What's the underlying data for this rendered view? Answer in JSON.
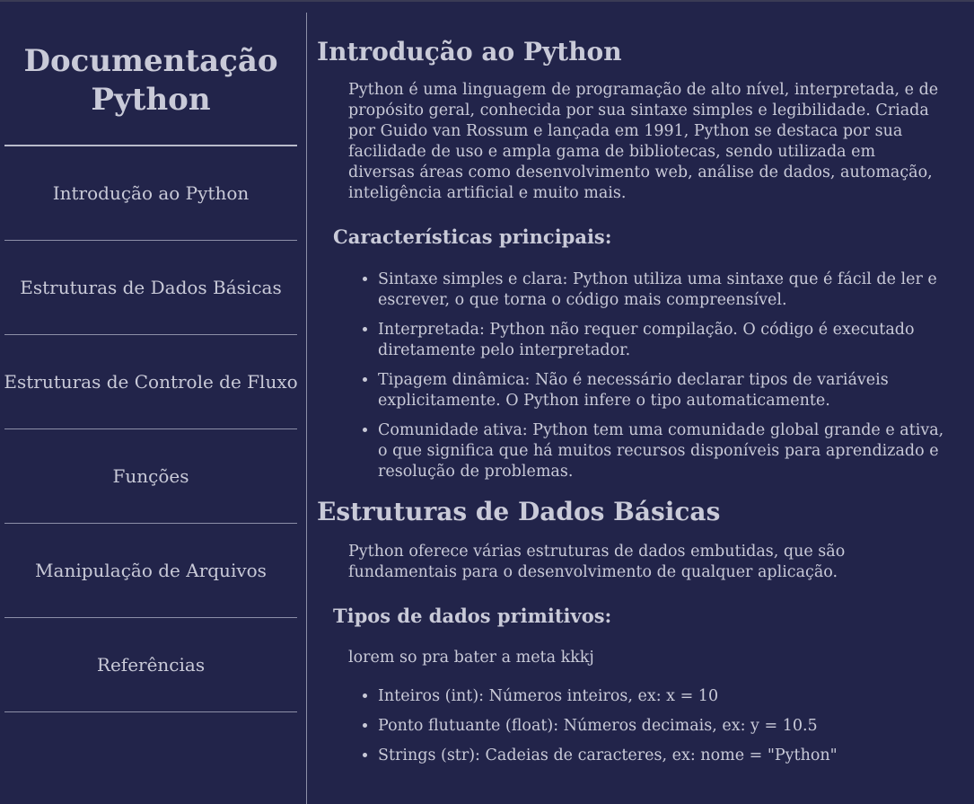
{
  "sidebar": {
    "title_line1": "Documentação",
    "title_line2": "Python",
    "items": [
      {
        "label": "Introdução ao Python"
      },
      {
        "label": "Estruturas de Dados Básicas"
      },
      {
        "label": "Estruturas de Controle de Fluxo"
      },
      {
        "label": "Funções"
      },
      {
        "label": "Manipulação de Arquivos"
      },
      {
        "label": "Referências"
      }
    ]
  },
  "sections": [
    {
      "title": "Introdução ao Python",
      "intro": "Python é uma linguagem de programação de alto nível, interpretada, e de propósito geral, conhecida por sua sintaxe simples e legibilidade. Criada por Guido van Rossum e lançada em 1991, Python se destaca por sua facilidade de uso e ampla gama de bibliotecas, sendo utilizada em diversas áreas como desenvolvimento web, análise de dados, automação, inteligência artificial e muito mais.",
      "subtitle": "Características principais:",
      "bullets": [
        "Sintaxe simples e clara: Python utiliza uma sintaxe que é fácil de ler e escrever, o que torna o código mais compreensível.",
        "Interpretada: Python não requer compilação. O código é executado diretamente pelo interpretador.",
        "Tipagem dinâmica: Não é necessário declarar tipos de variáveis explicitamente. O Python infere o tipo automaticamente.",
        "Comunidade ativa: Python tem uma comunidade global grande e ativa, o que significa que há muitos recursos disponíveis para aprendizado e resolução de problemas."
      ]
    },
    {
      "title": "Estruturas de Dados Básicas",
      "intro": "Python oferece várias estruturas de dados embutidas, que são fundamentais para o desenvolvimento de qualquer aplicação.",
      "subtitle": "Tipos de dados primitivos:",
      "note": "lorem so pra bater a meta kkkj",
      "bullets": [
        "Inteiros (int): Números inteiros, ex: x = 10",
        "Ponto flutuante (float): Números decimais, ex: y = 10.5",
        "Strings (str): Cadeias de caracteres, ex: nome = \"Python\""
      ]
    }
  ]
}
